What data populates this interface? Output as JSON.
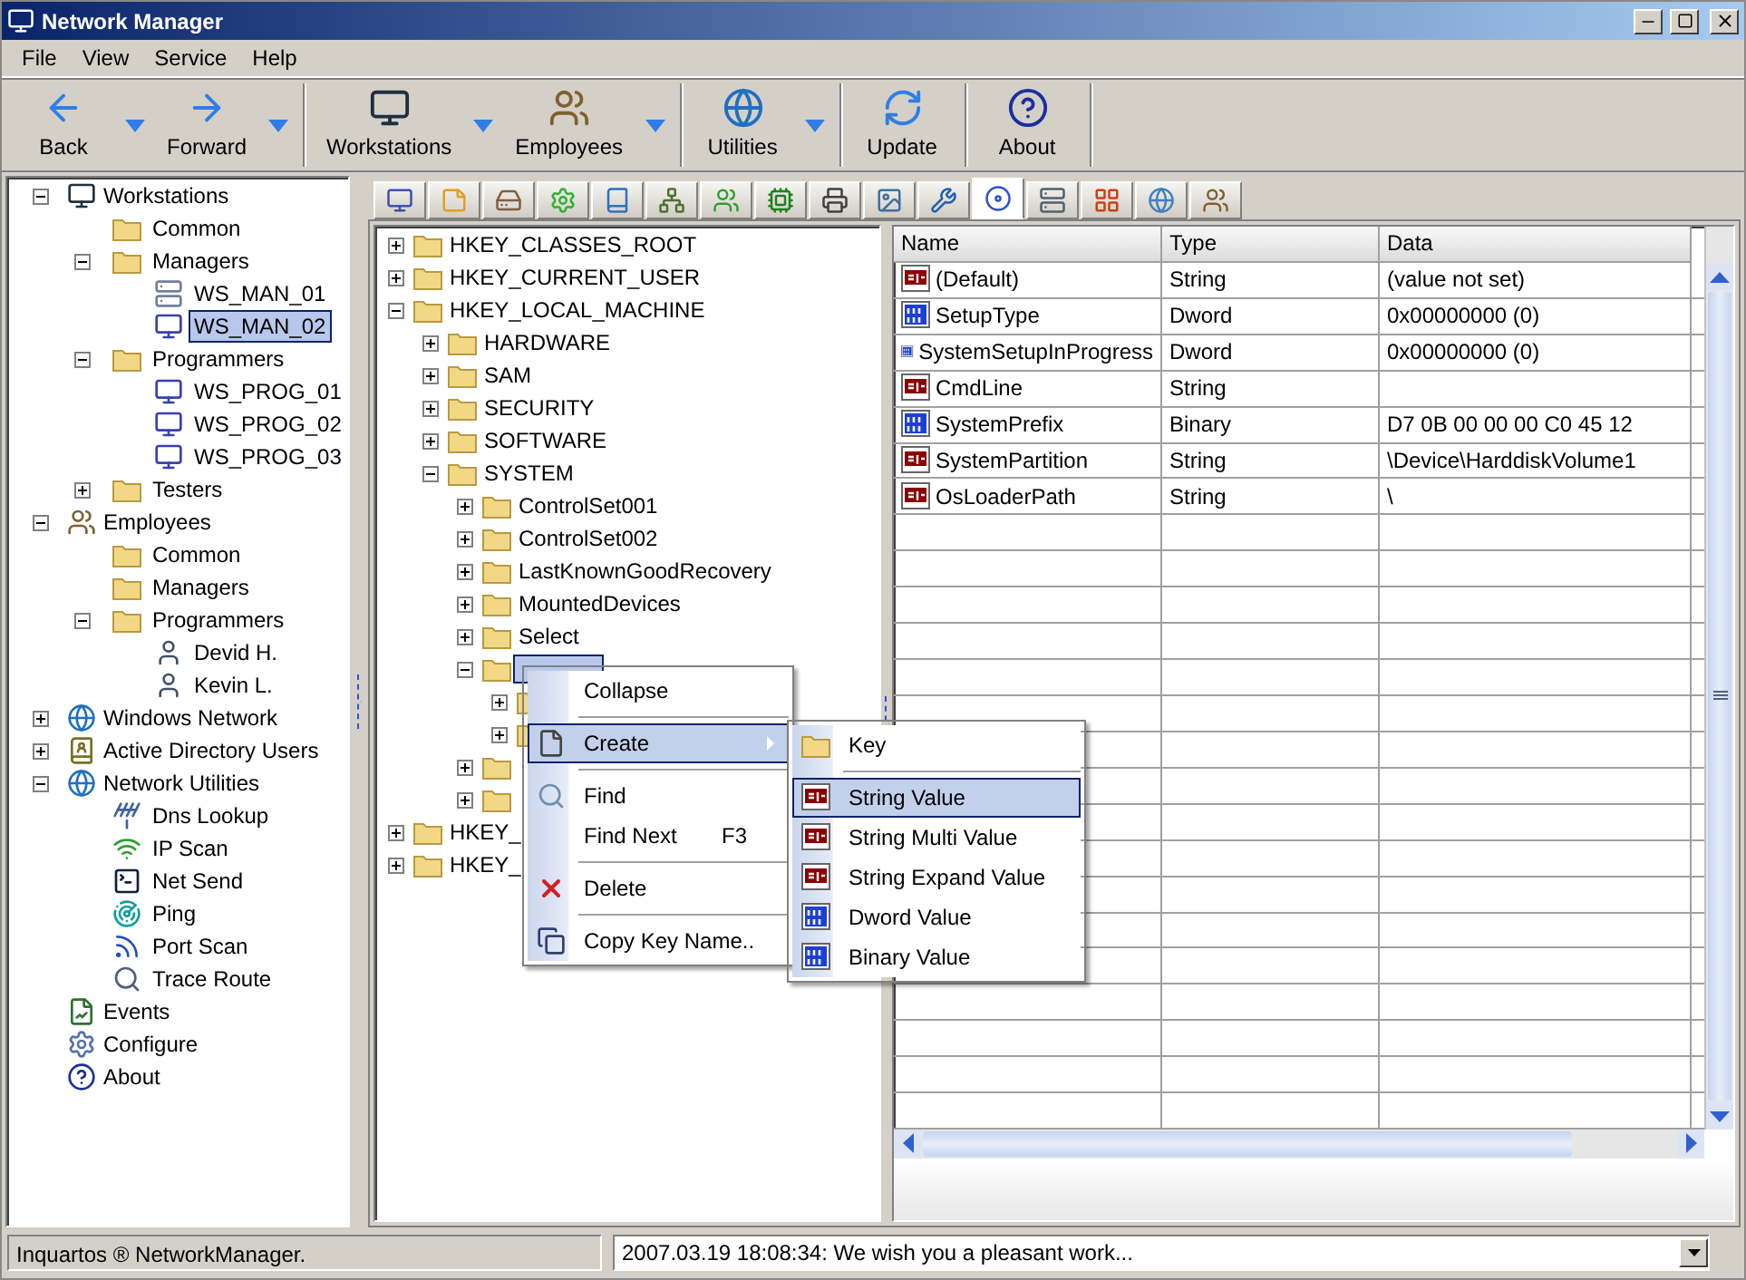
{
  "window": {
    "title": "Network Manager"
  },
  "menu_bar": [
    "File",
    "View",
    "Service",
    "Help"
  ],
  "toolbar": [
    [
      {
        "label": "Back",
        "kind": "back",
        "dropdown": true
      },
      {
        "label": "Forward",
        "kind": "forward",
        "dropdown": true
      }
    ],
    [
      {
        "label": "Workstations",
        "kind": "desktop",
        "dropdown": true
      },
      {
        "label": "Employees",
        "kind": "people",
        "dropdown": true
      }
    ],
    [
      {
        "label": "Utilities",
        "kind": "globe",
        "dropdown": true
      }
    ],
    [
      {
        "label": "Update",
        "kind": "refresh"
      }
    ],
    [
      {
        "label": "About",
        "kind": "help"
      }
    ]
  ],
  "sidebar_tree": [
    {
      "label": "Workstations",
      "kind": "desktop",
      "expanded": true,
      "selected": false,
      "children": [
        {
          "label": "Common",
          "kind": "folder",
          "selected": false
        },
        {
          "label": "Managers",
          "kind": "folder",
          "expanded": true,
          "selected": false,
          "children": [
            {
              "label": "WS_MAN_01",
              "kind": "server",
              "selected": false
            },
            {
              "label": "WS_MAN_02",
              "kind": "monitor",
              "selected": true
            }
          ]
        },
        {
          "label": "Programmers",
          "kind": "folder",
          "expanded": true,
          "selected": false,
          "children": [
            {
              "label": "WS_PROG_01",
              "kind": "monitor",
              "selected": false
            },
            {
              "label": "WS_PROG_02",
              "kind": "monitor",
              "selected": false
            },
            {
              "label": "WS_PROG_03",
              "kind": "monitor",
              "selected": false
            }
          ]
        },
        {
          "label": "Testers",
          "kind": "folder",
          "expanded": false,
          "selected": false
        }
      ]
    },
    {
      "label": "Employees",
      "kind": "people",
      "expanded": true,
      "selected": false,
      "children": [
        {
          "label": "Common",
          "kind": "folder",
          "selected": false
        },
        {
          "label": "Managers",
          "kind": "folder",
          "selected": false
        },
        {
          "label": "Programmers",
          "kind": "folder",
          "expanded": true,
          "selected": false,
          "children": [
            {
              "label": "Devid H.",
              "kind": "person",
              "selected": false
            },
            {
              "label": "Kevin L.",
              "kind": "person",
              "selected": false
            }
          ]
        }
      ]
    },
    {
      "label": "Windows Network",
      "kind": "globe",
      "expanded": false,
      "selected": false
    },
    {
      "label": "Active Directory Users",
      "kind": "directory",
      "expanded": false,
      "selected": false
    },
    {
      "label": "Network Utilities",
      "kind": "globe",
      "expanded": true,
      "selected": false,
      "children": [
        {
          "label": "Dns Lookup",
          "kind": "antenna",
          "selected": false
        },
        {
          "label": "IP Scan",
          "kind": "signal",
          "selected": false
        },
        {
          "label": "Net Send",
          "kind": "terminal",
          "selected": false
        },
        {
          "label": "Ping",
          "kind": "radar",
          "selected": false
        },
        {
          "label": "Port Scan",
          "kind": "wave",
          "selected": false
        },
        {
          "label": "Trace Route",
          "kind": "search",
          "selected": false
        }
      ]
    },
    {
      "label": "Events",
      "kind": "chart",
      "selected": false
    },
    {
      "label": "Configure",
      "kind": "configure",
      "selected": false
    },
    {
      "label": "About",
      "kind": "help",
      "selected": false
    }
  ],
  "panel_tabs": [
    {
      "selected": false
    },
    {
      "selected": false
    },
    {
      "selected": false
    },
    {
      "selected": false
    },
    {
      "selected": false
    },
    {
      "selected": false
    },
    {
      "selected": false
    },
    {
      "selected": false
    },
    {
      "selected": false
    },
    {
      "selected": false
    },
    {
      "selected": false
    },
    {
      "selected": true
    },
    {
      "selected": false
    },
    {
      "selected": false
    },
    {
      "selected": false
    },
    {
      "selected": false
    }
  ],
  "registry_tree": [
    {
      "label": "HKEY_CLASSES_ROOT",
      "expanded": false,
      "selected": false
    },
    {
      "label": "HKEY_CURRENT_USER",
      "expanded": false,
      "selected": false
    },
    {
      "label": "HKEY_LOCAL_MACHINE",
      "expanded": true,
      "selected": false,
      "children": [
        {
          "label": "HARDWARE",
          "expanded": false,
          "selected": false
        },
        {
          "label": "SAM",
          "expanded": false,
          "selected": false
        },
        {
          "label": "SECURITY",
          "expanded": false,
          "selected": false
        },
        {
          "label": "SOFTWARE",
          "expanded": false,
          "selected": false
        },
        {
          "label": "SYSTEM",
          "expanded": true,
          "selected": false,
          "children": [
            {
              "label": "ControlSet001",
              "expanded": false,
              "selected": false
            },
            {
              "label": "ControlSet002",
              "expanded": false,
              "selected": false
            },
            {
              "label": "LastKnownGoodRecovery",
              "expanded": false,
              "selected": false
            },
            {
              "label": "MountedDevices",
              "expanded": false,
              "selected": false
            },
            {
              "label": "Select",
              "expanded": false,
              "selected": false
            },
            {
              "expanded": true,
              "selected": true,
              "children": [
                {
                  "expanded": false
                },
                {
                  "expanded": false
                }
              ]
            },
            {
              "expanded": false
            },
            {
              "expanded": false
            }
          ]
        }
      ]
    },
    {
      "label": "HKEY_",
      "expanded": false,
      "selected": false
    },
    {
      "label": "HKEY_",
      "expanded": false,
      "selected": false
    }
  ],
  "context_menu": [
    {
      "kind": "plain",
      "label": "Collapse",
      "selected": false
    },
    {
      "kind": "separator"
    },
    {
      "kind": "document",
      "label": "Create",
      "submenu": true,
      "selected": true
    },
    {
      "kind": "separator"
    },
    {
      "kind": "search",
      "label": "Find",
      "selected": false
    },
    {
      "kind": "plain",
      "label": "Find Next",
      "shortcut": "F3",
      "selected": false
    },
    {
      "kind": "separator"
    },
    {
      "kind": "delete",
      "label": "Delete",
      "selected": false
    },
    {
      "kind": "separator"
    },
    {
      "kind": "copy",
      "label": "Copy Key Name..",
      "selected": false
    }
  ],
  "submenu": [
    {
      "kind": "folder",
      "label": "Key",
      "selected": false
    },
    {
      "kind": "separator"
    },
    {
      "kind": "string",
      "label": "String Value",
      "selected": true
    },
    {
      "kind": "string",
      "label": "String Multi Value",
      "selected": false
    },
    {
      "kind": "string",
      "label": "String Expand Value",
      "selected": false
    },
    {
      "kind": "binary",
      "label": "Dword Value",
      "selected": false
    },
    {
      "kind": "binary",
      "label": "Binary Value",
      "selected": false
    }
  ],
  "table": {
    "columns": [
      "Name",
      "Type",
      "Data"
    ],
    "rows": [
      {
        "kind": "string",
        "name": "(Default)",
        "type": "String",
        "data": "(value not set)"
      },
      {
        "kind": "binary",
        "name": "SetupType",
        "type": "Dword",
        "data": "0x00000000 (0)"
      },
      {
        "kind": "binary",
        "name": "SystemSetupInProgress",
        "type": "Dword",
        "data": "0x00000000 (0)"
      },
      {
        "kind": "string",
        "name": "CmdLine",
        "type": "String"
      },
      {
        "kind": "binary",
        "name": "SystemPrefix",
        "type": "Binary",
        "data": "D7 0B 00 00 00 C0 45 12"
      },
      {
        "kind": "string",
        "name": "SystemPartition",
        "type": "String",
        "data": "\\Device\\HarddiskVolume1"
      },
      {
        "kind": "string",
        "name": "OsLoaderPath",
        "type": "String",
        "data": "\\"
      }
    ]
  },
  "status_bar": {
    "left": "Inquartos ® NetworkManager.",
    "message": "2007.03.19 18:08:34: We wish you a pleasant work..."
  }
}
